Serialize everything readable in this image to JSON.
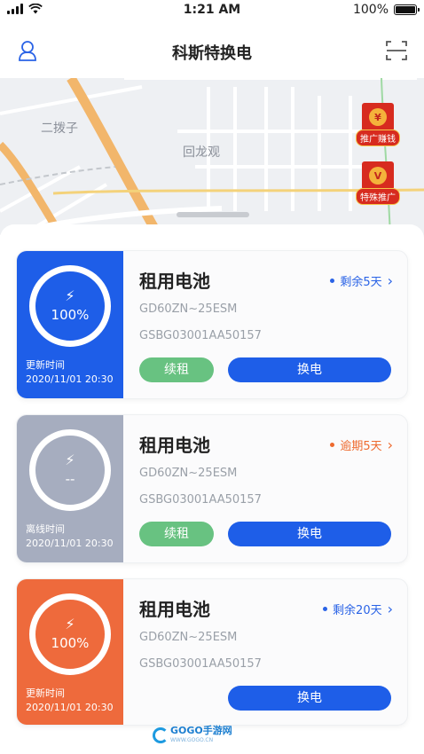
{
  "status_bar": {
    "time": "1:21 AM",
    "battery": "100%"
  },
  "nav": {
    "title": "科斯特换电"
  },
  "map": {
    "labels": [
      "二拨子",
      "回龙观"
    ],
    "promos": [
      {
        "label": "推广赚钱",
        "icon_char": "¥"
      },
      {
        "label": "特殊推广",
        "icon_char": "V"
      }
    ]
  },
  "cards": [
    {
      "name": "租用电池",
      "status": "剩余5天",
      "status_color": "#2a63e6",
      "percent": "100%",
      "update_label": "更新时间",
      "update_time": "2020/11/01 20:30",
      "model": "GD60ZN~25ESM",
      "serial": "GSBG03001AA50157",
      "renew_label": "续租",
      "swap_label": "换电",
      "side_color": "#1e5ee8"
    },
    {
      "name": "租用电池",
      "status": "逾期5天",
      "status_color": "#ee6a2e",
      "percent": "--",
      "update_label": "离线时间",
      "update_time": "2020/11/01 20:30",
      "model": "GD60ZN~25ESM",
      "serial": "GSBG03001AA50157",
      "renew_label": "续租",
      "swap_label": "换电",
      "side_color": "#a6adbf"
    },
    {
      "name": "租用电池",
      "status": "剩余20天",
      "status_color": "#2a63e6",
      "percent": "100%",
      "update_label": "更新时间",
      "update_time": "2020/11/01 20:30",
      "model": "GD60ZN~25ESM",
      "serial": "GSBG03001AA50157",
      "swap_label": "换电",
      "side_color": "#ee6a3c"
    }
  ],
  "watermark": {
    "text": "GOGO手游网",
    "sub": "WWW.GOGO.CN"
  }
}
